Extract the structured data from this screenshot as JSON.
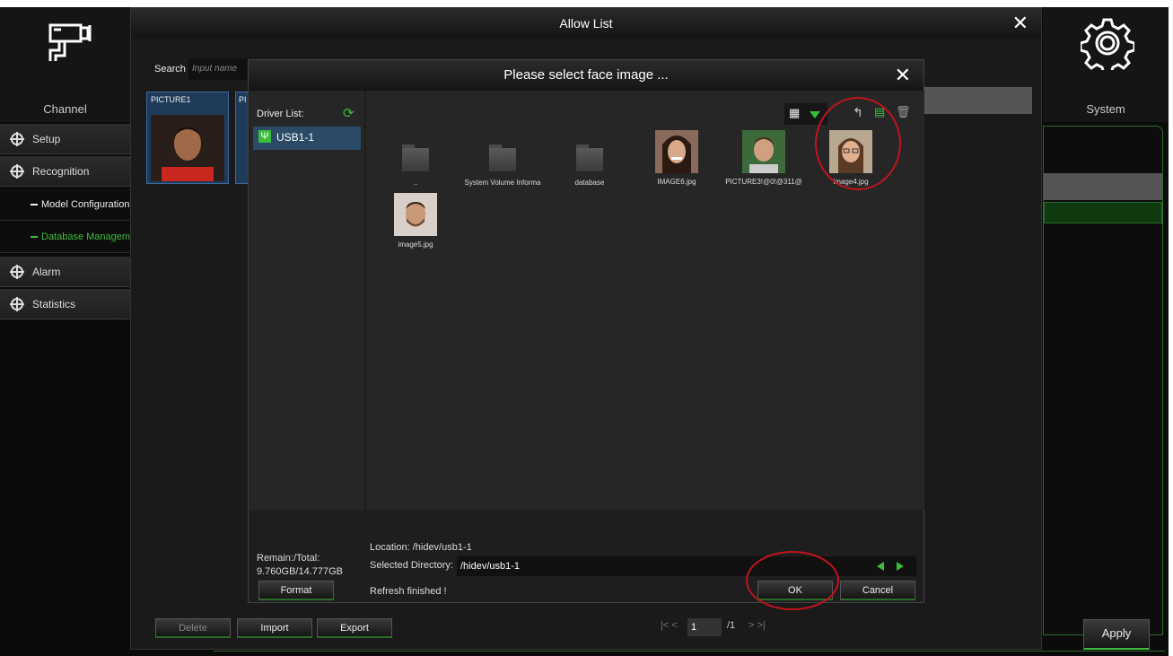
{
  "nav": {
    "channel_label": "Channel",
    "system_label": "System",
    "items": [
      {
        "label": "Setup"
      },
      {
        "label": "Recognition"
      },
      {
        "label": "Alarm"
      },
      {
        "label": "Statistics"
      }
    ],
    "subitems": [
      {
        "label": "Model Configuration"
      },
      {
        "label": "Database Management"
      }
    ]
  },
  "allow_list": {
    "title": "Allow List",
    "search_label": "Search",
    "search_placeholder": "Input name",
    "cards": [
      "PICTURE1",
      "PI"
    ],
    "buttons": {
      "delete": "Delete",
      "import": "Import",
      "export": "Export"
    },
    "pager": {
      "current": "1",
      "total": "/1"
    },
    "apply": "Apply"
  },
  "dialog": {
    "title": "Please select face image ...",
    "driver_list_label": "Driver List:",
    "drivers": [
      "USB1-1"
    ],
    "files": [
      {
        "name": "..",
        "type": "folder"
      },
      {
        "name": "System Volume Informa",
        "type": "folder"
      },
      {
        "name": "database",
        "type": "folder"
      },
      {
        "name": "IMAGE6.jpg",
        "type": "image"
      },
      {
        "name": "PICTURE3!@0!@311@",
        "type": "image"
      },
      {
        "name": "image4.jpg",
        "type": "image"
      },
      {
        "name": "image5.jpg",
        "type": "image"
      }
    ],
    "remain_label": "Remain:/Total:",
    "remain_value": "9.760GB/14.777GB",
    "format_button": "Format",
    "location": "Location: /hidev/usb1-1",
    "selected_dir_label": "Selected Directory:",
    "selected_dir_value": "/hidev/usb1-1",
    "status": "Refresh finished !",
    "ok_button": "OK",
    "cancel_button": "Cancel"
  },
  "colors": {
    "accent_green": "#3dbb3d",
    "highlight_red": "#c0141c",
    "selection_blue": "#2a4a66"
  }
}
